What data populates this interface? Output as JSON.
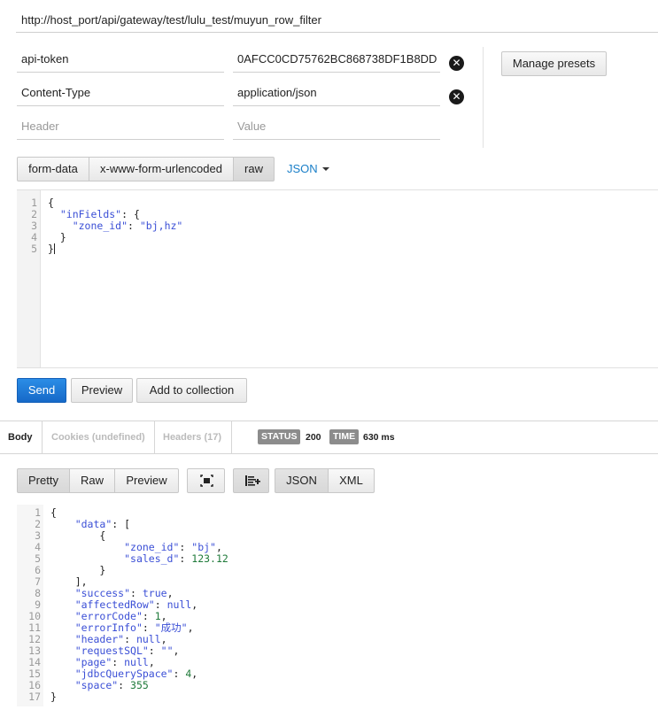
{
  "request": {
    "url": "http://host_port/api/gateway/test/lulu_test/muyun_row_filter",
    "headers": [
      {
        "key": "api-token",
        "value": "0AFCC0CD75762BC868738DF1B8DD"
      },
      {
        "key": "Content-Type",
        "value": "application/json"
      }
    ],
    "header_placeholder": "Header",
    "value_placeholder": "Value",
    "manage_presets_label": "Manage presets",
    "delete_icon_glyph": "✕",
    "body_tabs": [
      "form-data",
      "x-www-form-urlencoded",
      "raw"
    ],
    "body_type_label": "JSON",
    "body_lines": [
      "{",
      "  \"inFields\": {",
      "    \"zone_id\": \"bj,hz\"",
      "  }",
      "}"
    ],
    "line_numbers": [
      "1",
      "2",
      "3",
      "4",
      "5"
    ],
    "send_label": "Send",
    "preview_label": "Preview",
    "add_collection_label": "Add to collection"
  },
  "response": {
    "tabs": [
      "Body",
      "Cookies (undefined)",
      "Headers (17)"
    ],
    "status_badge": "STATUS",
    "status_value": "200",
    "time_badge": "TIME",
    "time_value": "630 ms",
    "view_tabs": [
      "Pretty",
      "Raw",
      "Preview"
    ],
    "format_tabs": [
      "JSON",
      "XML"
    ],
    "line_numbers": [
      "1",
      "2",
      "3",
      "4",
      "5",
      "6",
      "7",
      "8",
      "9",
      "10",
      "11",
      "12",
      "13",
      "14",
      "15",
      "16",
      "17"
    ],
    "body": [
      {
        "t": "p",
        "v": "{"
      },
      {
        "i": "    ",
        "k": "\"data\"",
        "r": ": ["
      },
      {
        "i": "        ",
        "t": "p",
        "v": "{"
      },
      {
        "i": "            ",
        "k": "\"zone_id\"",
        "r": ": ",
        "s": "\"bj\"",
        "e": ","
      },
      {
        "i": "            ",
        "k": "\"sales_d\"",
        "r": ": ",
        "n": "123.12"
      },
      {
        "i": "        ",
        "t": "p",
        "v": "}"
      },
      {
        "i": "    ",
        "t": "p",
        "v": "],"
      },
      {
        "i": "    ",
        "k": "\"success\"",
        "r": ": ",
        "s": "true",
        "e": ","
      },
      {
        "i": "    ",
        "k": "\"affectedRow\"",
        "r": ": ",
        "s": "null",
        "e": ","
      },
      {
        "i": "    ",
        "k": "\"errorCode\"",
        "r": ": ",
        "n": "1",
        "e": ","
      },
      {
        "i": "    ",
        "k": "\"errorInfo\"",
        "r": ": ",
        "s": "\"成功\"",
        "e": ","
      },
      {
        "i": "    ",
        "k": "\"header\"",
        "r": ": ",
        "s": "null",
        "e": ","
      },
      {
        "i": "    ",
        "k": "\"requestSQL\"",
        "r": ": ",
        "s": "\"\"",
        "e": ","
      },
      {
        "i": "    ",
        "k": "\"page\"",
        "r": ": ",
        "s": "null",
        "e": ","
      },
      {
        "i": "    ",
        "k": "\"jdbcQuerySpace\"",
        "r": ": ",
        "n": "4",
        "e": ","
      },
      {
        "i": "    ",
        "k": "\"space\"",
        "r": ": ",
        "n": "355"
      },
      {
        "t": "p",
        "v": "}"
      }
    ]
  },
  "icons": {
    "delete": "circle-x-icon",
    "fullscreen": "fullscreen-icon",
    "wrap": "wrap-lines-icon"
  }
}
